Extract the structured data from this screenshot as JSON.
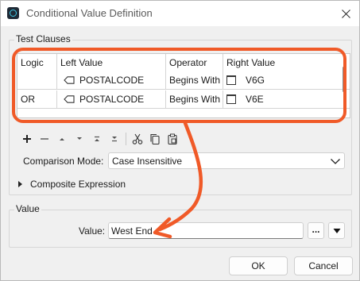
{
  "window": {
    "title": "Conditional Value Definition",
    "app_icon": "fme-app-icon",
    "close_icon": "close-icon"
  },
  "test_clauses": {
    "group_label": "Test Clauses",
    "columns": [
      "Logic",
      "Left Value",
      "Operator",
      "Right Value"
    ],
    "rows": [
      {
        "logic": "",
        "left_value": "POSTALCODE",
        "operator": "Begins With",
        "right_value": "V6G"
      },
      {
        "logic": "OR",
        "left_value": "POSTALCODE",
        "operator": "Begins With",
        "right_value": "V6E"
      }
    ]
  },
  "toolbar": {
    "icons": [
      "add-icon",
      "remove-icon",
      "move-up-icon",
      "move-down-icon",
      "move-top-icon",
      "move-bottom-icon",
      "cut-icon",
      "copy-icon",
      "paste-icon"
    ]
  },
  "comparison": {
    "label": "Comparison Mode:",
    "selected": "Case Insensitive"
  },
  "composite": {
    "label": "Composite Expression"
  },
  "value_group": {
    "group_label": "Value",
    "label": "Value:",
    "value": "West End",
    "ellipsis_label": "..."
  },
  "buttons": {
    "ok": "OK",
    "cancel": "Cancel"
  },
  "annotation": {
    "color": "#f05a28"
  }
}
